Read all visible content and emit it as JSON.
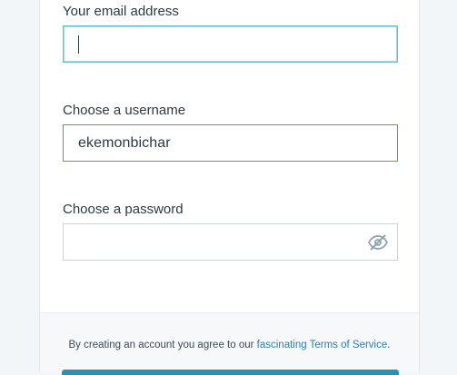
{
  "form": {
    "email": {
      "label": "Your email address",
      "value": "",
      "focused": true
    },
    "username": {
      "label": "Choose a username",
      "value": "ekemonbichar"
    },
    "password": {
      "label": "Choose a password",
      "value": "",
      "visibility_icon": "eye-slash-icon"
    }
  },
  "footer": {
    "tos_prefix": "By creating an account you agree to our ",
    "tos_link": "fascinating Terms of Service",
    "tos_suffix": "."
  },
  "colors": {
    "focus_border": "#62c2d8",
    "valid_border": "#5aa160",
    "link": "#2d7fae",
    "primary_button": "#2e8fb0"
  }
}
